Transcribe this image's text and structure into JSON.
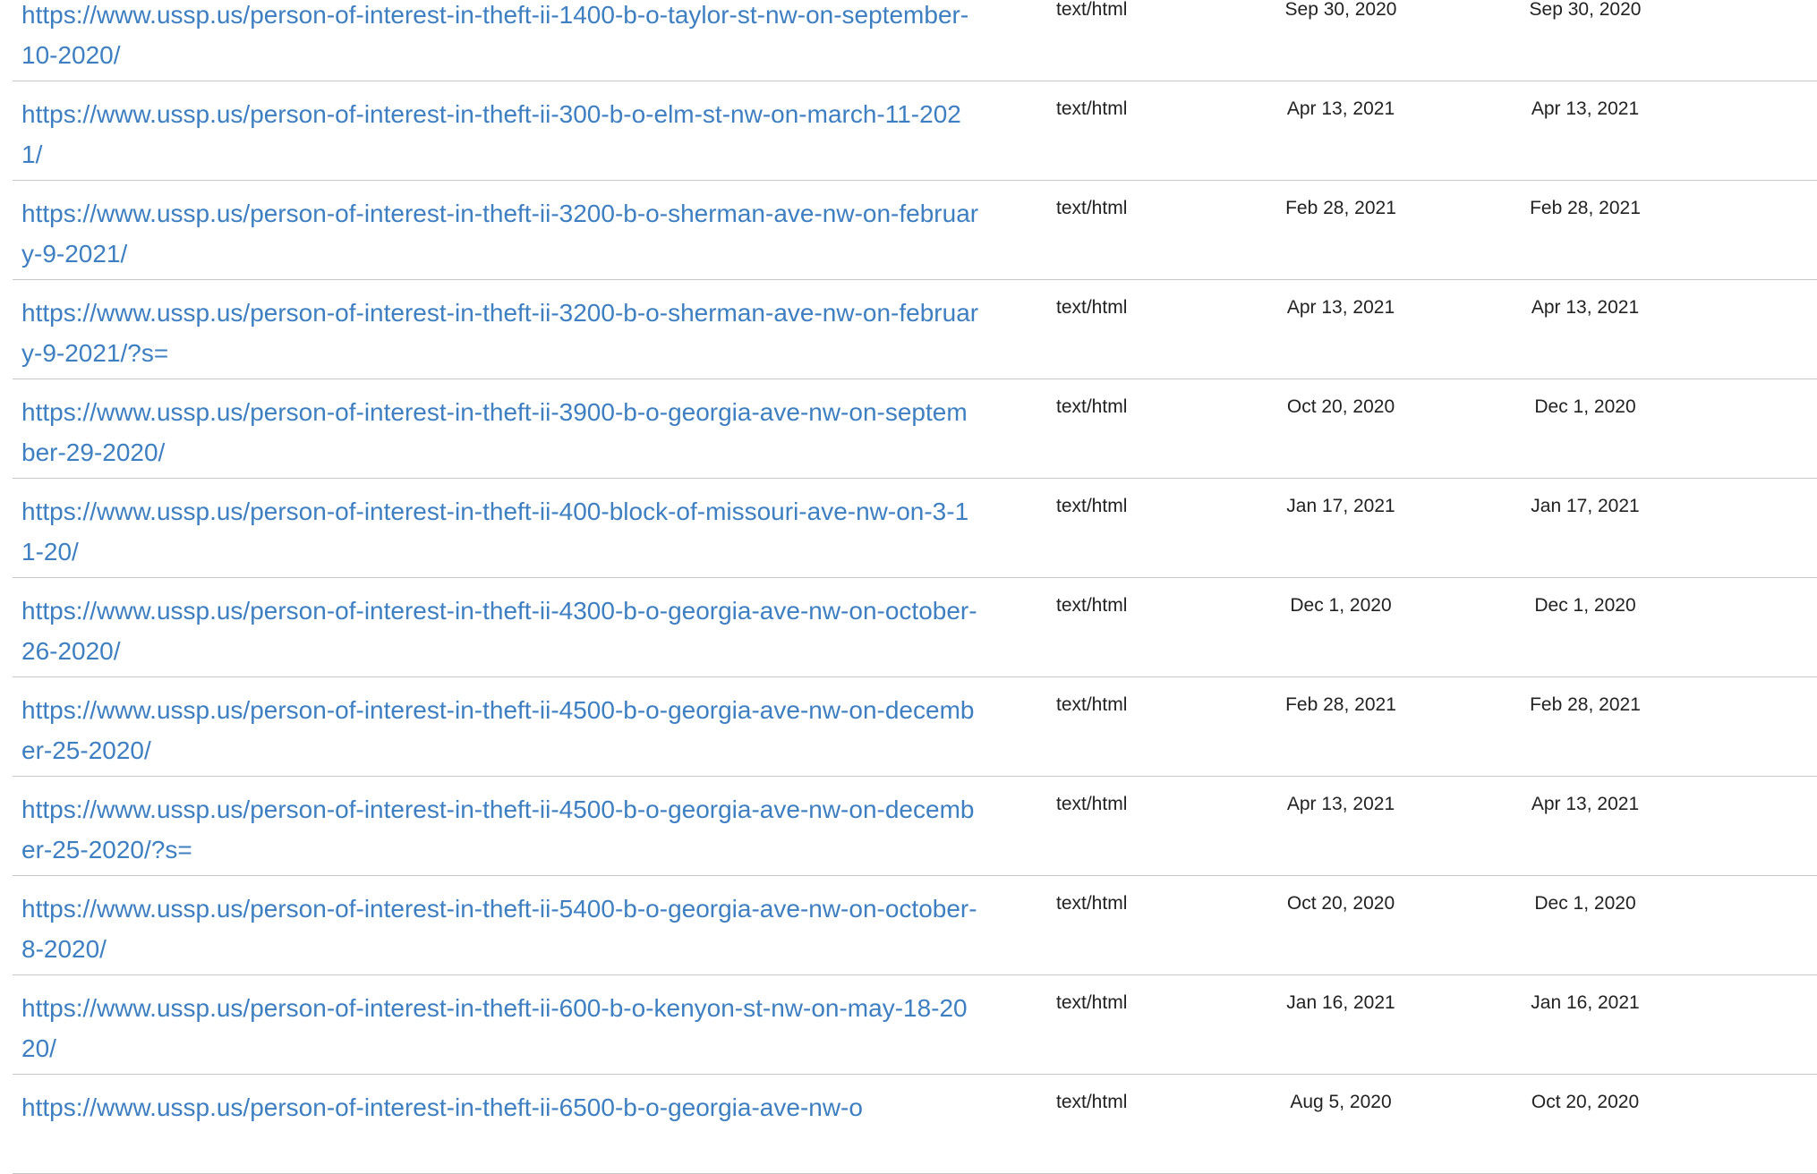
{
  "rows": [
    {
      "url": "https://www.ussp.us/person-of-interest-in-theft-ii-1400-b-o-taylor-st-nw-on-september-10-2020/",
      "mime": "text/html",
      "from": "Sep 30, 2020",
      "to": "Sep 30, 2020"
    },
    {
      "url": "https://www.ussp.us/person-of-interest-in-theft-ii-300-b-o-elm-st-nw-on-march-11-2021/",
      "mime": "text/html",
      "from": "Apr 13, 2021",
      "to": "Apr 13, 2021"
    },
    {
      "url": "https://www.ussp.us/person-of-interest-in-theft-ii-3200-b-o-sherman-ave-nw-on-february-9-2021/",
      "mime": "text/html",
      "from": "Feb 28, 2021",
      "to": "Feb 28, 2021"
    },
    {
      "url": "https://www.ussp.us/person-of-interest-in-theft-ii-3200-b-o-sherman-ave-nw-on-february-9-2021/?s=",
      "mime": "text/html",
      "from": "Apr 13, 2021",
      "to": "Apr 13, 2021"
    },
    {
      "url": "https://www.ussp.us/person-of-interest-in-theft-ii-3900-b-o-georgia-ave-nw-on-september-29-2020/",
      "mime": "text/html",
      "from": "Oct 20, 2020",
      "to": "Dec 1, 2020"
    },
    {
      "url": "https://www.ussp.us/person-of-interest-in-theft-ii-400-block-of-missouri-ave-nw-on-3-11-20/",
      "mime": "text/html",
      "from": "Jan 17, 2021",
      "to": "Jan 17, 2021"
    },
    {
      "url": "https://www.ussp.us/person-of-interest-in-theft-ii-4300-b-o-georgia-ave-nw-on-october-26-2020/",
      "mime": "text/html",
      "from": "Dec 1, 2020",
      "to": "Dec 1, 2020"
    },
    {
      "url": "https://www.ussp.us/person-of-interest-in-theft-ii-4500-b-o-georgia-ave-nw-on-december-25-2020/",
      "mime": "text/html",
      "from": "Feb 28, 2021",
      "to": "Feb 28, 2021"
    },
    {
      "url": "https://www.ussp.us/person-of-interest-in-theft-ii-4500-b-o-georgia-ave-nw-on-december-25-2020/?s=",
      "mime": "text/html",
      "from": "Apr 13, 2021",
      "to": "Apr 13, 2021"
    },
    {
      "url": "https://www.ussp.us/person-of-interest-in-theft-ii-5400-b-o-georgia-ave-nw-on-october-8-2020/",
      "mime": "text/html",
      "from": "Oct 20, 2020",
      "to": "Dec 1, 2020"
    },
    {
      "url": "https://www.ussp.us/person-of-interest-in-theft-ii-600-b-o-kenyon-st-nw-on-may-18-2020/",
      "mime": "text/html",
      "from": "Jan 16, 2021",
      "to": "Jan 16, 2021"
    },
    {
      "url": "https://www.ussp.us/person-of-interest-in-theft-ii-6500-b-o-georgia-ave-nw-o",
      "mime": "text/html",
      "from": "Aug 5, 2020",
      "to": "Oct 20, 2020"
    }
  ]
}
